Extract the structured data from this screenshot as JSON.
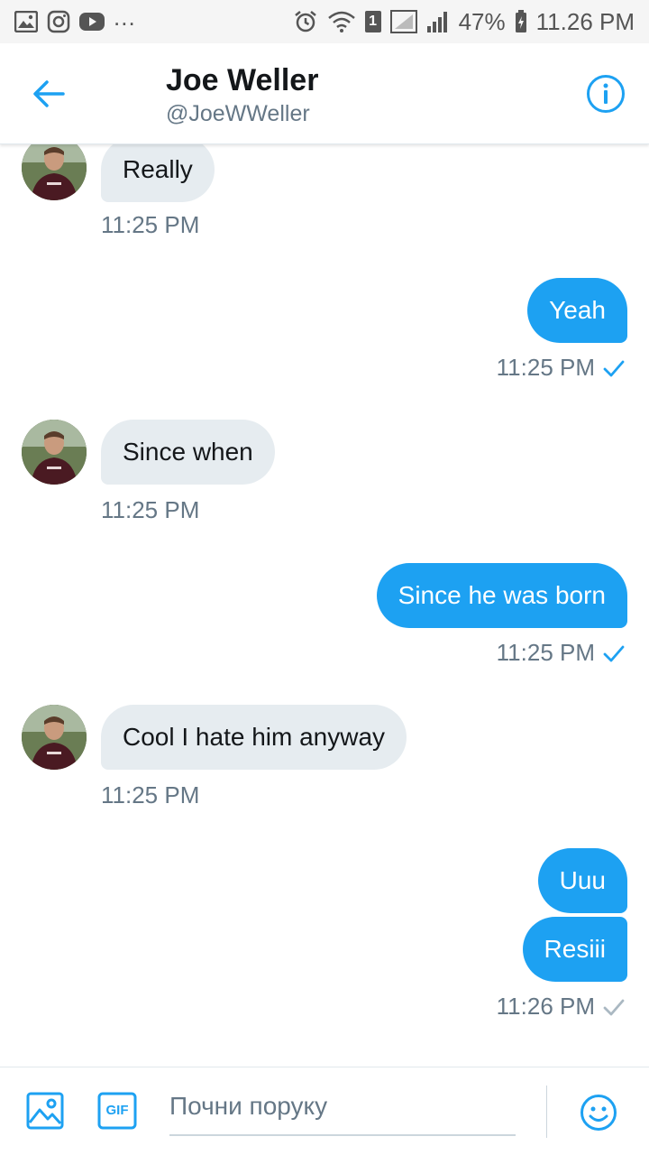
{
  "status_bar": {
    "icons_left": [
      "gallery-icon",
      "instagram-icon",
      "youtube-icon"
    ],
    "overflow": "...",
    "sim_label": "1",
    "battery": "47%",
    "time": "11.26 PM"
  },
  "header": {
    "name": "Joe Weller",
    "handle": "@JoeWWeller"
  },
  "messages": [
    {
      "direction": "in",
      "text": "Really",
      "time": "11:25 PM"
    },
    {
      "direction": "out",
      "text": "Yeah",
      "time": "11:25 PM",
      "status": "read"
    },
    {
      "direction": "in",
      "text": "Since when",
      "time": "11:25 PM"
    },
    {
      "direction": "out",
      "text": "Since he was born",
      "time": "11:25 PM",
      "status": "read"
    },
    {
      "direction": "in",
      "text": "Cool I hate him anyway",
      "time": "11:25 PM"
    },
    {
      "direction": "out",
      "text": "Uuu"
    },
    {
      "direction": "out",
      "text": "Resiii",
      "time": "11:26 PM",
      "status": "sent"
    }
  ],
  "composer": {
    "placeholder": "Почни поруку",
    "gif_label": "GIF"
  },
  "colors": {
    "accent": "#1da1f2",
    "incoming_bubble": "#e6ecf0",
    "muted_text": "#657786",
    "sent_check": "#aab8c2"
  }
}
